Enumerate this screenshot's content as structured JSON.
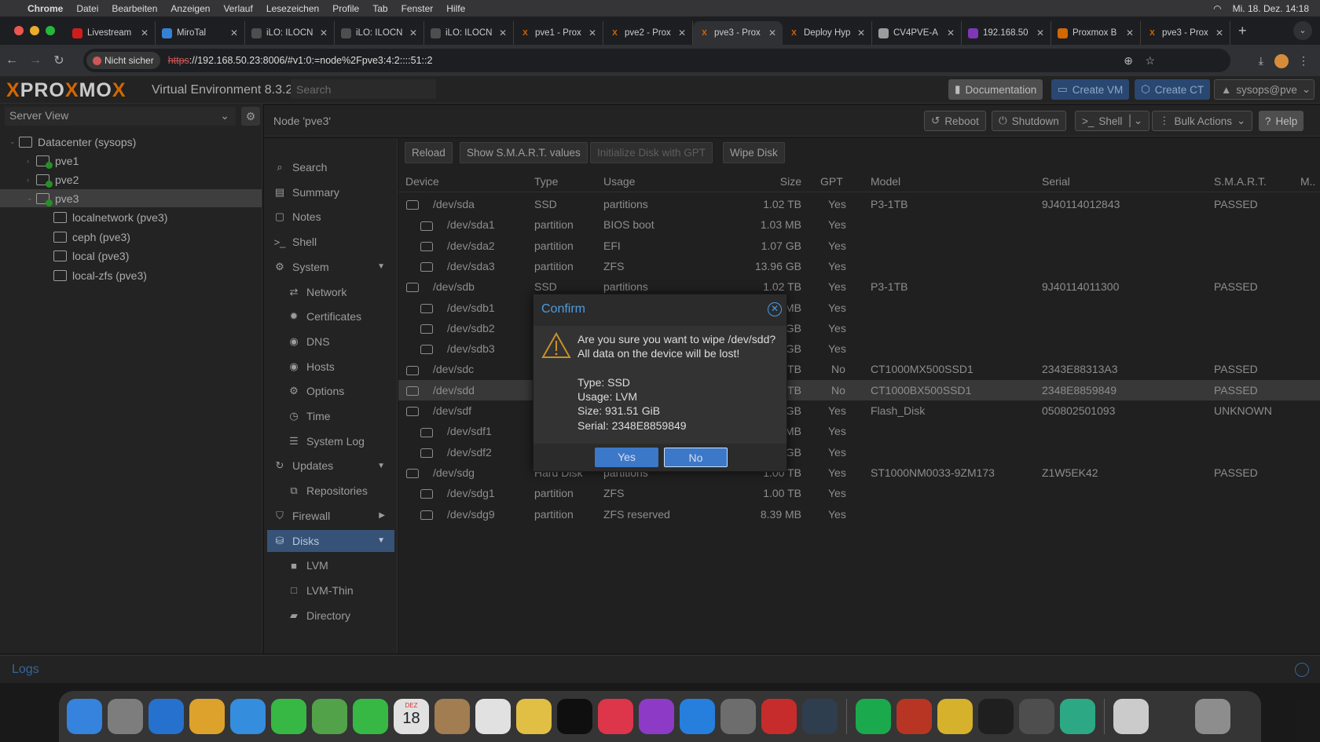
{
  "menubar": {
    "app": "Chrome",
    "items": [
      "Datei",
      "Bearbeiten",
      "Anzeigen",
      "Verlauf",
      "Lesezeichen",
      "Profile",
      "Tab",
      "Fenster",
      "Hilfe"
    ],
    "clock": "Mi. 18. Dez. 14:18"
  },
  "tabs": [
    {
      "title": "Livestream",
      "icon": "youtube-icon",
      "color": "#e02020"
    },
    {
      "title": "MiroTal",
      "icon": "cube-icon",
      "color": "#3a8ee6"
    },
    {
      "title": "iLO: ILOCN",
      "icon": "ilo-icon",
      "color": "#555"
    },
    {
      "title": "iLO: ILOCN",
      "icon": "ilo-icon",
      "color": "#555"
    },
    {
      "title": "iLO: ILOCN",
      "icon": "ilo-icon",
      "color": "#555"
    },
    {
      "title": "pve1 - Prox",
      "icon": "proxmox-icon",
      "color": "#e57000"
    },
    {
      "title": "pve2 - Prox",
      "icon": "proxmox-icon",
      "color": "#e57000"
    },
    {
      "title": "pve3 - Prox",
      "icon": "proxmox-icon",
      "color": "#e57000",
      "active": true
    },
    {
      "title": "Deploy Hyp",
      "icon": "proxmox-icon",
      "color": "#e57000"
    },
    {
      "title": "CV4PVE-A",
      "icon": "globe-icon",
      "color": "#aaa"
    },
    {
      "title": "192.168.50",
      "icon": "rom-icon",
      "color": "#8a3cc8"
    },
    {
      "title": "Proxmox B",
      "icon": "proxmox-backup-icon",
      "color": "#e57000"
    },
    {
      "title": "pve3 - Prox",
      "icon": "proxmox-icon",
      "color": "#e57000"
    }
  ],
  "address": {
    "security": "Nicht sicher",
    "scheme": "https",
    "rest": "://192.168.50.23:8006/#v1:0:=node%2Fpve3:4:2::::51::2"
  },
  "header": {
    "brand": "PROXMOX",
    "version": "Virtual Environment 8.3.2",
    "search_placeholder": "Search",
    "documentation": "Documentation",
    "create_vm": "Create VM",
    "create_ct": "Create CT",
    "user": "sysops@pve"
  },
  "left": {
    "view": "Server View",
    "tree": [
      {
        "label": "Datacenter (sysops)",
        "level": 0,
        "icon": "datacenter-icon"
      },
      {
        "label": "pve1",
        "level": 1,
        "icon": "node-icon"
      },
      {
        "label": "pve2",
        "level": 1,
        "icon": "node-icon"
      },
      {
        "label": "pve3",
        "level": 1,
        "icon": "node-icon",
        "selected": true
      },
      {
        "label": "localnetwork (pve3)",
        "level": 2,
        "icon": "network-icon"
      },
      {
        "label": "ceph (pve3)",
        "level": 2,
        "icon": "storage-icon"
      },
      {
        "label": "local (pve3)",
        "level": 2,
        "icon": "storage-icon"
      },
      {
        "label": "local-zfs (pve3)",
        "level": 2,
        "icon": "storage-icon"
      }
    ]
  },
  "node": {
    "title": "Node 'pve3'",
    "reboot": "Reboot",
    "shutdown": "Shutdown",
    "shell": "Shell",
    "bulk": "Bulk Actions",
    "help": "Help"
  },
  "nav": [
    {
      "label": "Search",
      "icon": "search-icon",
      "glyph": "⌕"
    },
    {
      "label": "Summary",
      "icon": "summary-icon",
      "glyph": "▤"
    },
    {
      "label": "Notes",
      "icon": "notes-icon",
      "glyph": "▢"
    },
    {
      "label": "Shell",
      "icon": "terminal-icon",
      "glyph": ">_"
    },
    {
      "label": "System",
      "icon": "cogs-icon",
      "glyph": "⚙",
      "arrow": "▼"
    },
    {
      "label": "Network",
      "icon": "exchange-icon",
      "glyph": "⇄",
      "sub": true
    },
    {
      "label": "Certificates",
      "icon": "certificate-icon",
      "glyph": "✹",
      "sub": true
    },
    {
      "label": "DNS",
      "icon": "globe-icon",
      "glyph": "◉",
      "sub": true
    },
    {
      "label": "Hosts",
      "icon": "globe-icon",
      "glyph": "◉",
      "sub": true
    },
    {
      "label": "Options",
      "icon": "gear-icon",
      "glyph": "⚙",
      "sub": true
    },
    {
      "label": "Time",
      "icon": "clock-icon",
      "glyph": "◷",
      "sub": true
    },
    {
      "label": "System Log",
      "icon": "list-icon",
      "glyph": "☰",
      "sub": true
    },
    {
      "label": "Updates",
      "icon": "refresh-icon",
      "glyph": "↻",
      "arrow": "▼"
    },
    {
      "label": "Repositories",
      "icon": "repository-icon",
      "glyph": "⧉",
      "sub": true
    },
    {
      "label": "Firewall",
      "icon": "shield-icon",
      "glyph": "⛉",
      "arrow": "▶"
    },
    {
      "label": "Disks",
      "icon": "disk-icon",
      "glyph": "⛁",
      "arrow": "▼",
      "selected": true
    },
    {
      "label": "LVM",
      "icon": "square-icon",
      "glyph": "■",
      "sub": true
    },
    {
      "label": "LVM-Thin",
      "icon": "square-outline-icon",
      "glyph": "□",
      "sub": true
    },
    {
      "label": "Directory",
      "icon": "folder-icon",
      "glyph": "▰",
      "sub": true
    }
  ],
  "toolbar": {
    "reload": "Reload",
    "smart": "Show S.M.A.R.T. values",
    "init": "Initialize Disk with GPT",
    "wipe": "Wipe Disk"
  },
  "columns": [
    "Device",
    "Type",
    "Usage",
    "Size",
    "GPT",
    "Model",
    "Serial",
    "S.M.A.R.T.",
    "M.."
  ],
  "rows": [
    {
      "device": "/dev/sda",
      "type": "SSD",
      "usage": "partitions",
      "size": "1.02 TB",
      "gpt": "Yes",
      "model": "P3-1TB",
      "serial": "9J40114012843",
      "smart": "PASSED",
      "level": 0
    },
    {
      "device": "/dev/sda1",
      "type": "partition",
      "usage": "BIOS boot",
      "size": "1.03 MB",
      "gpt": "Yes",
      "level": 1
    },
    {
      "device": "/dev/sda2",
      "type": "partition",
      "usage": "EFI",
      "size": "1.07 GB",
      "gpt": "Yes",
      "level": 1
    },
    {
      "device": "/dev/sda3",
      "type": "partition",
      "usage": "ZFS",
      "size": "13.96 GB",
      "gpt": "Yes",
      "level": 1
    },
    {
      "device": "/dev/sdb",
      "type": "SSD",
      "usage": "partitions",
      "size": "1.02 TB",
      "gpt": "Yes",
      "model": "P3-1TB",
      "serial": "9J40114011300",
      "smart": "PASSED",
      "level": 0
    },
    {
      "device": "/dev/sdb1",
      "size": "MB",
      "gpt": "Yes",
      "level": 1
    },
    {
      "device": "/dev/sdb2",
      "size": "GB",
      "gpt": "Yes",
      "level": 1
    },
    {
      "device": "/dev/sdb3",
      "size": "GB",
      "gpt": "Yes",
      "level": 1
    },
    {
      "device": "/dev/sdc",
      "size": "TB",
      "gpt": "No",
      "model": "CT1000MX500SSD1",
      "serial": "2343E88313A3",
      "smart": "PASSED",
      "level": 0
    },
    {
      "device": "/dev/sdd",
      "size": "TB",
      "gpt": "No",
      "model": "CT1000BX500SSD1",
      "serial": "2348E8859849",
      "smart": "PASSED",
      "level": 0,
      "selected": true
    },
    {
      "device": "/dev/sdf",
      "size": "GB",
      "gpt": "Yes",
      "model": "Flash_Disk",
      "serial": "050802501093",
      "smart": "UNKNOWN",
      "level": 0
    },
    {
      "device": "/dev/sdf1",
      "size": "MB",
      "gpt": "Yes",
      "level": 1
    },
    {
      "device": "/dev/sdf2",
      "size": "GB",
      "gpt": "Yes",
      "level": 1
    },
    {
      "device": "/dev/sdg",
      "type": "Hard Disk",
      "usage": "partitions",
      "size": "1.00 TB",
      "gpt": "Yes",
      "model": "ST1000NM0033-9ZM173",
      "serial": "Z1W5EK42",
      "smart": "PASSED",
      "level": 0
    },
    {
      "device": "/dev/sdg1",
      "type": "partition",
      "usage": "ZFS",
      "size": "1.00 TB",
      "gpt": "Yes",
      "level": 1
    },
    {
      "device": "/dev/sdg9",
      "type": "partition",
      "usage": "ZFS reserved",
      "size": "8.39 MB",
      "gpt": "Yes",
      "level": 1
    }
  ],
  "dialog": {
    "title": "Confirm",
    "line1": "Are you sure you want to wipe /dev/sdd?",
    "line2": "All data on the device will be lost!",
    "type": "Type: SSD",
    "usage": "Usage: LVM",
    "size": "Size: 931.51 GiB",
    "serial": "Serial: 2348E8859849",
    "yes": "Yes",
    "no": "No"
  },
  "logs": {
    "label": "Logs"
  },
  "dock": [
    {
      "name": "finder",
      "color": "#3b8ff0"
    },
    {
      "name": "launchpad",
      "color": "#888"
    },
    {
      "name": "safari",
      "color": "#2a7be0"
    },
    {
      "name": "photos",
      "color": "#f0b030"
    },
    {
      "name": "mail",
      "color": "#3a9af0"
    },
    {
      "name": "messages",
      "color": "#3cc84a"
    },
    {
      "name": "maps",
      "color": "#5ab050"
    },
    {
      "name": "facetime",
      "color": "#3cc84a"
    },
    {
      "name": "calendar",
      "color": "#f5f5f5",
      "text": "18",
      "sub": "DEZ"
    },
    {
      "name": "contacts",
      "color": "#b08858"
    },
    {
      "name": "reminders",
      "color": "#f5f5f5"
    },
    {
      "name": "notes",
      "color": "#f5d04a"
    },
    {
      "name": "tv",
      "color": "#111"
    },
    {
      "name": "music",
      "color": "#f03a50"
    },
    {
      "name": "podcasts",
      "color": "#9a40d8"
    },
    {
      "name": "app-store",
      "color": "#2a8af0"
    },
    {
      "name": "system-settings",
      "color": "#777"
    },
    {
      "name": "anydesk",
      "color": "#d83030"
    },
    {
      "name": "quicktime",
      "color": "#345"
    },
    {
      "sep": true
    },
    {
      "name": "spotify",
      "color": "#1db954"
    },
    {
      "name": "app-red",
      "color": "#c83a28"
    },
    {
      "name": "chrome",
      "color": "#e8c030"
    },
    {
      "name": "terminal",
      "color": "#222"
    },
    {
      "name": "calculator",
      "color": "#555"
    },
    {
      "name": "sync",
      "color": "#30b890"
    },
    {
      "sep": true
    },
    {
      "name": "archive",
      "color": "#ddd"
    },
    {
      "name": "downloads",
      "color": "#3a3a3a"
    },
    {
      "name": "trash",
      "color": "#999"
    }
  ]
}
